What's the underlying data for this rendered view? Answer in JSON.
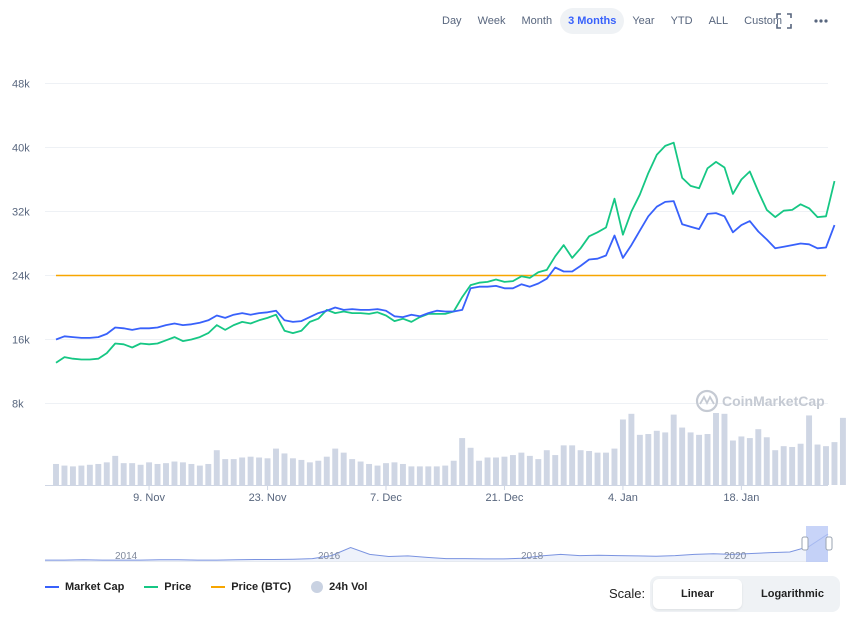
{
  "toolbar": {
    "ranges": [
      "Day",
      "Week",
      "Month",
      "3 Months",
      "Year",
      "YTD",
      "ALL",
      "Custom"
    ],
    "active_range": "3 Months",
    "icons": [
      "fullscreen-icon",
      "more-options-icon"
    ]
  },
  "watermark": "CoinMarketCap",
  "chart_data": {
    "type": "line",
    "x": [
      "2020-10-29",
      "2020-10-30",
      "2020-10-31",
      "2020-11-01",
      "2020-11-02",
      "2020-11-03",
      "2020-11-04",
      "2020-11-05",
      "2020-11-06",
      "2020-11-07",
      "2020-11-08",
      "2020-11-09",
      "2020-11-10",
      "2020-11-11",
      "2020-11-12",
      "2020-11-13",
      "2020-11-14",
      "2020-11-15",
      "2020-11-16",
      "2020-11-17",
      "2020-11-18",
      "2020-11-19",
      "2020-11-20",
      "2020-11-21",
      "2020-11-22",
      "2020-11-23",
      "2020-11-24",
      "2020-11-25",
      "2020-11-26",
      "2020-11-27",
      "2020-11-28",
      "2020-11-29",
      "2020-11-30",
      "2020-12-01",
      "2020-12-02",
      "2020-12-03",
      "2020-12-04",
      "2020-12-05",
      "2020-12-06",
      "2020-12-07",
      "2020-12-08",
      "2020-12-09",
      "2020-12-10",
      "2020-12-11",
      "2020-12-12",
      "2020-12-13",
      "2020-12-14",
      "2020-12-15",
      "2020-12-16",
      "2020-12-17",
      "2020-12-18",
      "2020-12-19",
      "2020-12-20",
      "2020-12-21",
      "2020-12-22",
      "2020-12-23",
      "2020-12-24",
      "2020-12-25",
      "2020-12-26",
      "2020-12-27",
      "2020-12-28",
      "2020-12-29",
      "2020-12-30",
      "2020-12-31",
      "2021-01-01",
      "2021-01-02",
      "2021-01-03",
      "2021-01-04",
      "2021-01-05",
      "2021-01-06",
      "2021-01-07",
      "2021-01-08",
      "2021-01-09",
      "2021-01-10",
      "2021-01-11",
      "2021-01-12",
      "2021-01-13",
      "2021-01-14",
      "2021-01-15",
      "2021-01-16",
      "2021-01-17",
      "2021-01-18",
      "2021-01-19",
      "2021-01-20",
      "2021-01-21",
      "2021-01-22",
      "2021-01-23",
      "2021-01-24",
      "2021-01-25",
      "2021-01-26",
      "2021-01-27",
      "2021-01-28"
    ],
    "series": [
      {
        "name": "Market Cap",
        "color": "#3861fb",
        "values": [
          16000,
          16400,
          16300,
          16200,
          16200,
          16300,
          16700,
          17500,
          17400,
          17200,
          17400,
          17400,
          17500,
          17800,
          18000,
          17800,
          17900,
          18100,
          18400,
          19000,
          18700,
          19100,
          19300,
          19100,
          19300,
          19400,
          19600,
          18400,
          18200,
          18300,
          18800,
          19300,
          19600,
          20000,
          19700,
          19800,
          19700,
          19700,
          19800,
          19600,
          18900,
          18800,
          19100,
          18900,
          19300,
          19600,
          19500,
          19500,
          19700,
          22400,
          22600,
          22600,
          22700,
          22400,
          22400,
          22900,
          22600,
          23000,
          23600,
          25000,
          24500,
          24500,
          25200,
          26000,
          26100,
          26500,
          29000,
          26200,
          27800,
          29600,
          31400,
          32600,
          33200,
          33300,
          30400,
          30100,
          29800,
          31700,
          31800,
          31400,
          29400,
          30300,
          30800,
          29500,
          28500,
          27400,
          27600,
          27800,
          28000,
          27900,
          27400,
          27500,
          30300
        ]
      },
      {
        "name": "Price",
        "color": "#16c784",
        "values": [
          13100,
          13800,
          13600,
          13500,
          13500,
          13600,
          14300,
          15500,
          15400,
          15000,
          15500,
          15400,
          15500,
          15900,
          16300,
          15800,
          16000,
          16300,
          16800,
          17800,
          17200,
          17800,
          18200,
          18000,
          18400,
          18700,
          19100,
          17100,
          16800,
          17100,
          18200,
          18600,
          19700,
          19300,
          19500,
          19300,
          19300,
          19200,
          19400,
          19000,
          18300,
          18600,
          18200,
          18800,
          19200,
          19200,
          19200,
          19500,
          21300,
          22800,
          23100,
          23200,
          23500,
          23200,
          23300,
          23900,
          23700,
          24400,
          24700,
          26400,
          27800,
          26200,
          27400,
          28900,
          29400,
          30000,
          33600,
          29100,
          32000,
          34100,
          36800,
          39100,
          40200,
          40600,
          36200,
          35200,
          34900,
          37400,
          38200,
          37500,
          34200,
          36000,
          37000,
          34500,
          32200,
          31300,
          32100,
          32200,
          32900,
          32400,
          31300,
          31400,
          35800
        ]
      },
      {
        "name": "Price (BTC)",
        "color": "#f7a600",
        "values": [
          1,
          1,
          1,
          1,
          1,
          1,
          1,
          1,
          1,
          1,
          1,
          1,
          1,
          1,
          1,
          1,
          1,
          1,
          1,
          1,
          1,
          1,
          1,
          1,
          1,
          1,
          1,
          1,
          1,
          1,
          1,
          1,
          1,
          1,
          1,
          1,
          1,
          1,
          1,
          1,
          1,
          1,
          1,
          1,
          1,
          1,
          1,
          1,
          1,
          1,
          1,
          1,
          1,
          1,
          1,
          1,
          1,
          1,
          1,
          1,
          1,
          1,
          1,
          1,
          1,
          1,
          1,
          1,
          1,
          1,
          1,
          1,
          1,
          1,
          1,
          1,
          1,
          1,
          1,
          1,
          1,
          1,
          1,
          1,
          1,
          1,
          1,
          1,
          1,
          1,
          1,
          1,
          1
        ]
      }
    ],
    "volume": {
      "name": "24h Vol",
      "values": [
        2.6,
        2.4,
        2.3,
        2.4,
        2.5,
        2.6,
        2.8,
        3.6,
        2.7,
        2.7,
        2.5,
        2.8,
        2.6,
        2.7,
        2.9,
        2.8,
        2.6,
        2.4,
        2.6,
        4.3,
        3.2,
        3.2,
        3.4,
        3.5,
        3.4,
        3.3,
        4.5,
        3.9,
        3.3,
        3.1,
        2.8,
        3.0,
        3.5,
        4.5,
        4.0,
        3.2,
        2.9,
        2.6,
        2.4,
        2.7,
        2.8,
        2.6,
        2.3,
        2.3,
        2.3,
        2.3,
        2.4,
        3.0,
        5.8,
        4.6,
        3.0,
        3.4,
        3.4,
        3.5,
        3.7,
        4.0,
        3.6,
        3.2,
        4.3,
        3.7,
        4.9,
        4.9,
        4.3,
        4.2,
        4.0,
        4.0,
        4.5,
        8.1,
        8.8,
        6.2,
        6.3,
        6.7,
        6.5,
        8.7,
        7.1,
        6.5,
        6.2,
        6.3,
        8.9,
        8.8,
        5.5,
        6.0,
        5.8,
        6.9,
        5.9,
        4.3,
        4.8,
        4.7,
        5.1,
        8.6,
        5.0,
        4.8,
        5.3,
        8.3
      ]
    },
    "y_ticks": [
      "8k",
      "16k",
      "24k",
      "32k",
      "40k",
      "48k"
    ],
    "y_tick_values": [
      8000,
      16000,
      24000,
      32000,
      40000,
      48000
    ],
    "ylim": [
      0,
      52000
    ],
    "x_tick_labels": [
      "9. Nov",
      "23. Nov",
      "7. Dec",
      "21. Dec",
      "4. Jan",
      "18. Jan"
    ],
    "x_tick_dates": [
      "2020-11-09",
      "2020-11-23",
      "2020-12-07",
      "2020-12-21",
      "2021-01-04",
      "2021-01-18"
    ],
    "grid": true,
    "legend_position": "bottom-left",
    "btc_price_unit_level": 24000
  },
  "navigator": {
    "year_labels": [
      "2014",
      "2016",
      "2018",
      "2020"
    ],
    "values": [
      0.03,
      0.03,
      0.04,
      0.03,
      0.03,
      0.03,
      0.04,
      0.04,
      0.03,
      0.03,
      0.04,
      0.05,
      0.05,
      0.06,
      0.08,
      0.18,
      0.45,
      0.22,
      0.15,
      0.17,
      0.12,
      0.08,
      0.08,
      0.07,
      0.07,
      0.09,
      0.17,
      0.22,
      0.18,
      0.19,
      0.18,
      0.17,
      0.16,
      0.18,
      0.22,
      0.24,
      0.22,
      0.25,
      0.28,
      0.3,
      0.48,
      0.9
    ]
  },
  "legend": {
    "items": [
      {
        "label": "Market Cap",
        "color": "#3861fb",
        "kind": "line"
      },
      {
        "label": "Price",
        "color": "#16c784",
        "kind": "line"
      },
      {
        "label": "Price (BTC)",
        "color": "#f7a600",
        "kind": "line"
      },
      {
        "label": "24h Vol",
        "color": "#c9d2e2",
        "kind": "dot"
      }
    ]
  },
  "scale": {
    "label": "Scale:",
    "options": [
      "Linear",
      "Logarithmic"
    ],
    "active": "Linear"
  }
}
